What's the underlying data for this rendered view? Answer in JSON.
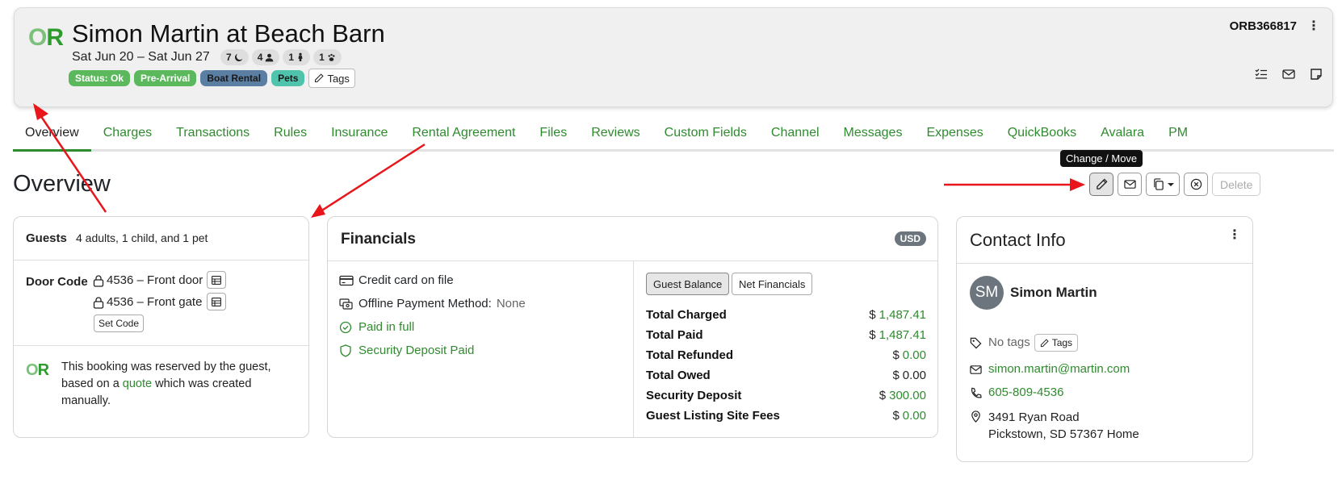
{
  "header": {
    "logo_o": "O",
    "logo_r": "R",
    "title": "Simon Martin at Beach Barn",
    "dates": "Sat Jun 20  –  Sat Jun 27",
    "pills": [
      {
        "value": "7",
        "icon": "moon-icon"
      },
      {
        "value": "4",
        "icon": "adult-icon"
      },
      {
        "value": "1",
        "icon": "child-icon"
      },
      {
        "value": "1",
        "icon": "paw-icon"
      }
    ],
    "badges": [
      "Status: Ok",
      "Pre-Arrival",
      "Boat Rental",
      "Pets"
    ],
    "tags_label": "Tags",
    "booking_code": "ORB366817",
    "icons": [
      "checklist-icon",
      "envelope-icon",
      "note-icon"
    ]
  },
  "tabs": [
    "Overview",
    "Charges",
    "Transactions",
    "Rules",
    "Insurance",
    "Rental Agreement",
    "Files",
    "Reviews",
    "Custom Fields",
    "Channel",
    "Messages",
    "Expenses",
    "QuickBooks",
    "Avalara",
    "PM"
  ],
  "page_title": "Overview",
  "actions": {
    "tooltip": "Change / Move",
    "delete_label": "Delete"
  },
  "guests": {
    "label": "Guests",
    "value": "4 adults, 1 child, and 1 pet",
    "door_code_label": "Door Code",
    "codes": [
      "4536 – Front door",
      "4536 – Front gate"
    ],
    "set_code_label": "Set Code",
    "reservation_text_1": "This booking was reserved by the guest,",
    "reservation_text_2a": "based on a ",
    "reservation_link": "quote",
    "reservation_text_2b": " which was created",
    "reservation_text_3": "manually."
  },
  "financials": {
    "title": "Financials",
    "currency": "USD",
    "credit_card": "Credit card on file",
    "offline_label": "Offline Payment Method:",
    "offline_value": "None",
    "paid_status": "Paid in full",
    "deposit_status": "Security Deposit Paid",
    "toggle_guest": "Guest Balance",
    "toggle_net": "Net Financials",
    "totals": [
      {
        "label": "Total Charged",
        "currency": "$",
        "amount": "1,487.41",
        "color": "#2e8b2e"
      },
      {
        "label": "Total Paid",
        "currency": "$",
        "amount": "1,487.41",
        "color": "#2e8b2e"
      },
      {
        "label": "Total Refunded",
        "currency": "$",
        "amount": "0.00",
        "color": "#2e8b2e"
      },
      {
        "label": "Total Owed",
        "currency": "$",
        "amount": "0.00",
        "color": "#222222"
      },
      {
        "label": "Security Deposit",
        "currency": "$",
        "amount": "300.00",
        "color": "#2e8b2e"
      },
      {
        "label": "Guest Listing Site Fees",
        "currency": "$",
        "amount": "0.00",
        "color": "#2e8b2e"
      }
    ]
  },
  "contact": {
    "title": "Contact Info",
    "initials": "SM",
    "name": "Simon Martin",
    "no_tags": "No tags",
    "tags_label": "Tags",
    "email": "simon.martin@martin.com",
    "phone": "605-809-4536",
    "address_1": "3491 Ryan Road",
    "address_2": "Pickstown, SD 57367 Home"
  },
  "colors": {
    "accent": "#2e8b2e",
    "annotation_arrow": "#e8161b"
  }
}
